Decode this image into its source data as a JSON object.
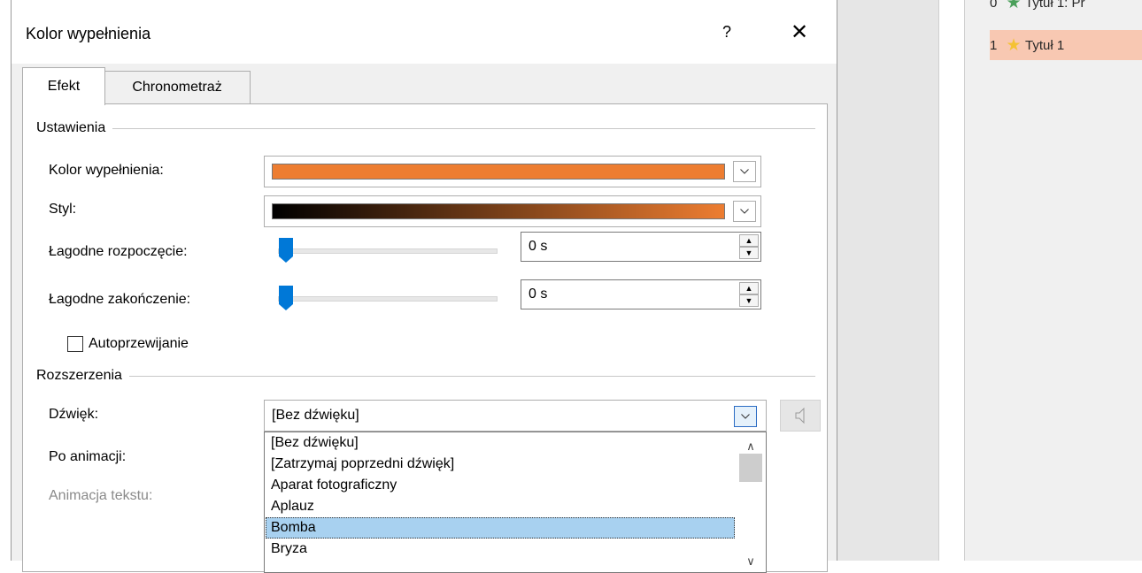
{
  "dialog": {
    "title": "Kolor wypełnienia",
    "help_label": "?",
    "close_label": "✕"
  },
  "tabs": [
    {
      "label": "Efekt",
      "active": true
    },
    {
      "label": "Chronometraż",
      "active": false
    }
  ],
  "settings": {
    "group_label": "Ustawienia",
    "fill_color_label": "Kolor wypełnienia:",
    "fill_color_value": "#ED7D31",
    "style_label": "Styl:",
    "style_gradient": [
      "#000000",
      "#ED7D31"
    ],
    "soft_start_label": "Łagodne rozpoczęcie:",
    "soft_start_value": "0 s",
    "soft_end_label": "Łagodne zakończenie:",
    "soft_end_value": "0 s",
    "auto_reverse_label": "Autoprzewijanie",
    "auto_reverse_checked": false
  },
  "extensions": {
    "group_label": "Rozszerzenia",
    "sound_label": "Dźwięk:",
    "sound_value": "[Bez dźwięku]",
    "after_anim_label": "Po animacji:",
    "text_anim_label": "Animacja tekstu:",
    "sound_options": [
      "[Bez dźwięku]",
      "[Zatrzymaj poprzedni dźwięk]",
      "Aparat fotograficzny",
      "Aplauz",
      "Bomba",
      "Bryza"
    ],
    "highlighted_option": "Bomba"
  },
  "animation_pane": {
    "items": [
      {
        "number": "0",
        "label": "Tytuł 1: Pr",
        "star_color": "#4aa05a"
      },
      {
        "number": "1",
        "label": "Tytuł 1",
        "star_color": "#f4c233",
        "selected": true
      }
    ]
  },
  "icons": {
    "help": "help-icon",
    "close": "close-icon",
    "chevron": "chevron-down-icon",
    "speaker": "speaker-icon",
    "star": "star-icon"
  }
}
